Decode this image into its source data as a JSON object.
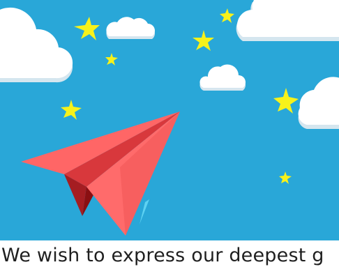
{
  "colors": {
    "sky": "#29a7d8",
    "cloud": "#ffffff",
    "cloud_shadow": "#d5e6ef",
    "star": "#f7f21a",
    "plane_light": "#ff6666",
    "plane_mid": "#f05656",
    "plane_dark": "#d8383c",
    "plane_shadow": "#8a0f12",
    "plane_trail": "#5ed2f2",
    "caption_text": "#1f1f1f"
  },
  "illustration": {
    "scene": "paper-plane-flying-in-sky",
    "elements": [
      "cloud-icon",
      "star-icon",
      "paper-plane-icon"
    ]
  },
  "caption": {
    "text": "We wish to express our deepest g"
  }
}
